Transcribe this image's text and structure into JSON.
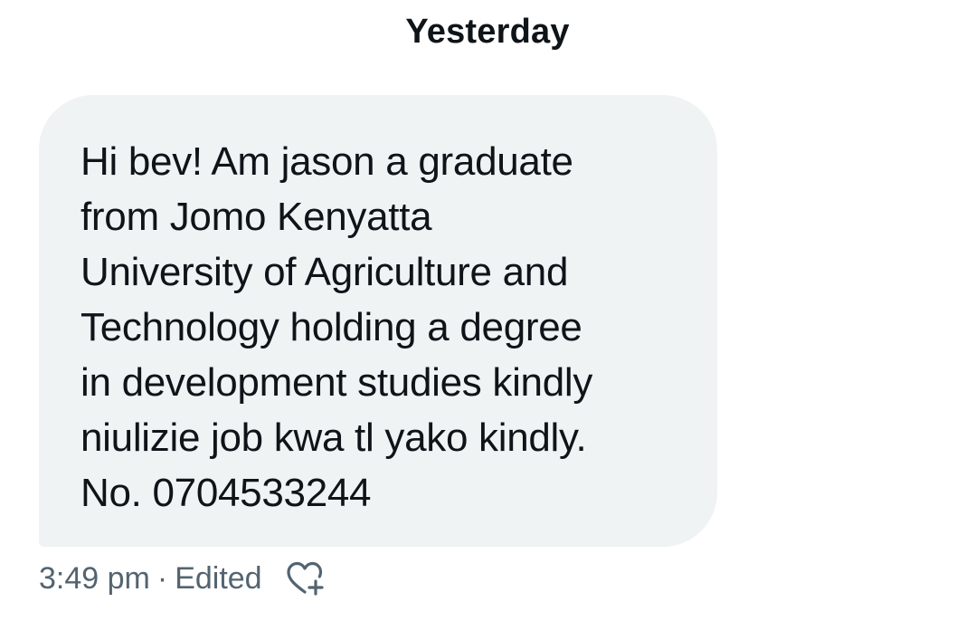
{
  "conversation": {
    "date_divider": "Yesterday",
    "messages": [
      {
        "text": "Hi bev! Am jason a graduate\nfrom Jomo Kenyatta\nUniversity of Agriculture and\nTechnology holding a degree\nin development studies kindly\nniulizie job kwa tl yako kindly.\nNo. 0704533244",
        "time": "3:49 pm",
        "separator": "·",
        "status": "Edited",
        "reaction_icon": "heart-plus-icon"
      }
    ]
  },
  "colors": {
    "bubble_bg": "#eff3f4",
    "text": "#0f1419",
    "meta": "#536471"
  }
}
